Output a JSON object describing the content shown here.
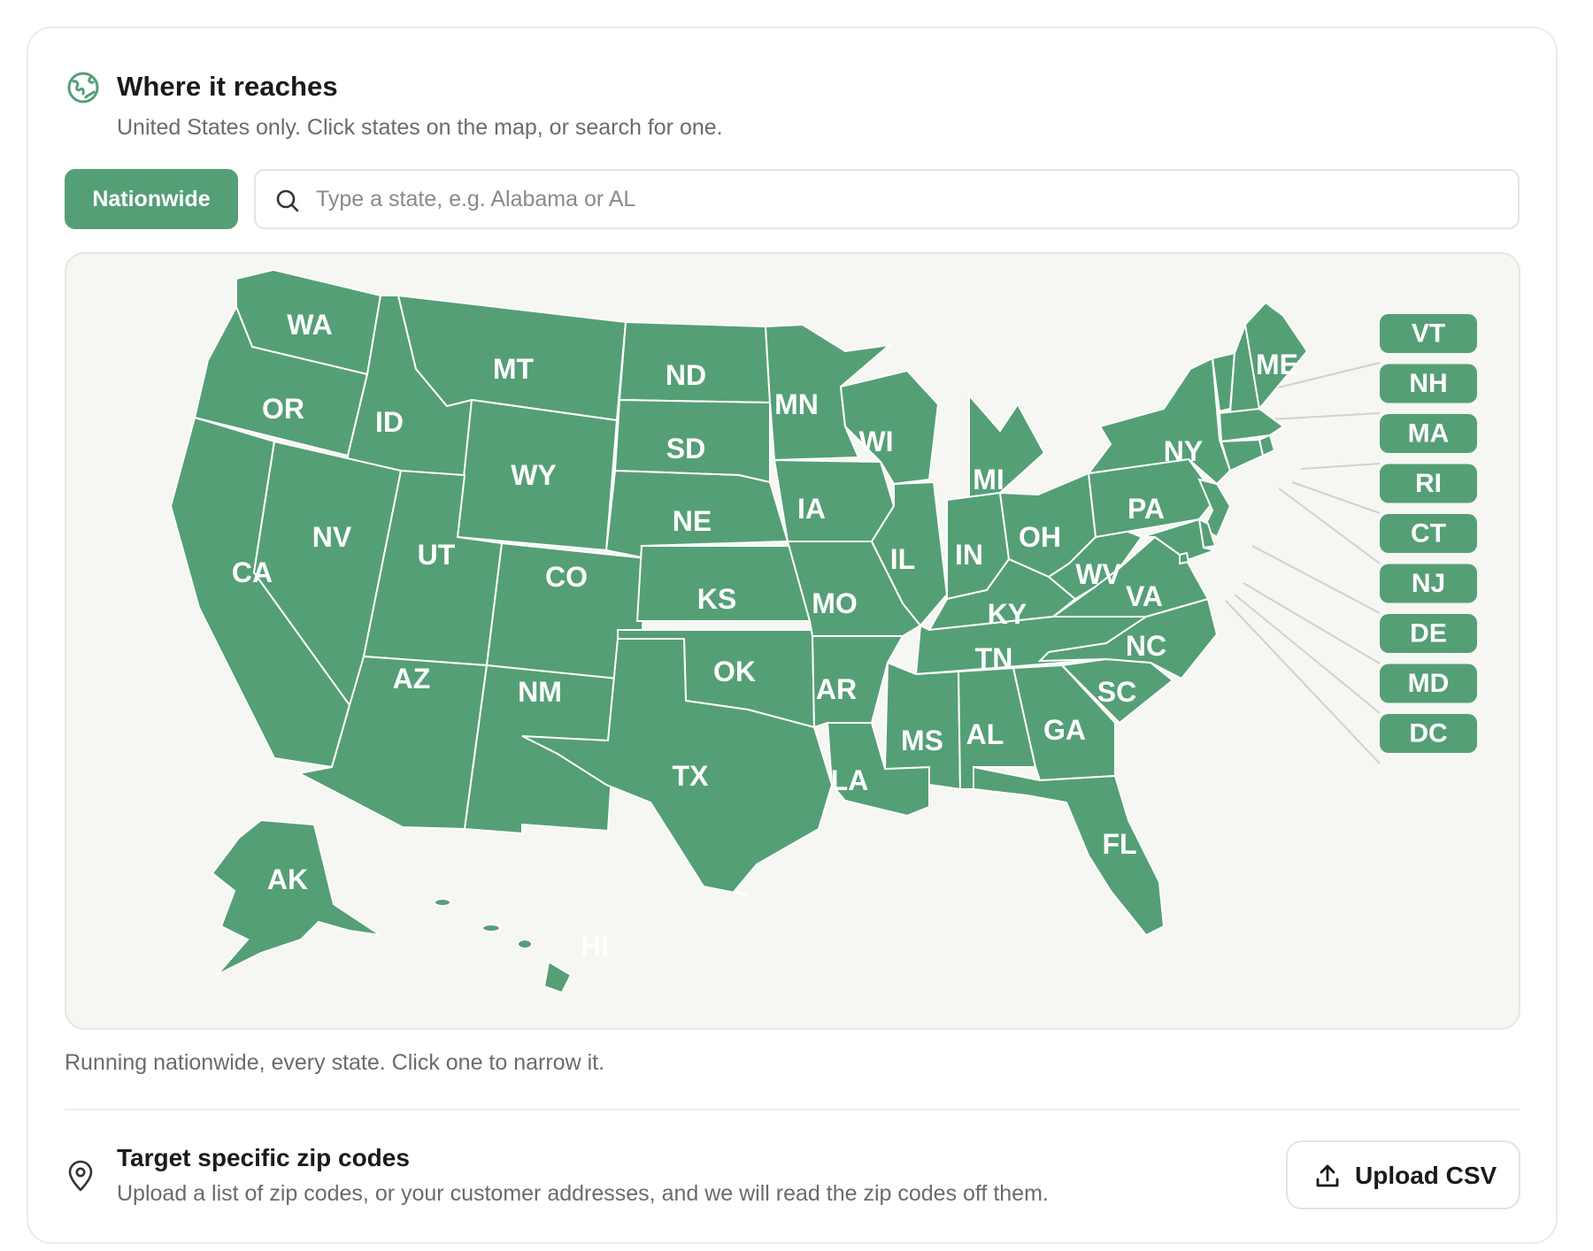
{
  "header": {
    "title": "Where it reaches",
    "subtitle": "United States only. Click states on the map, or search for one.",
    "icon": "globe-icon"
  },
  "controls": {
    "nationwide_label": "Nationwide",
    "search_placeholder": "Type a state, e.g. Alabama or AL"
  },
  "map": {
    "fill_color": "#559f76",
    "border_color": "#ffffff",
    "background_color": "#f6f6f3",
    "states": [
      "WA",
      "OR",
      "CA",
      "ID",
      "NV",
      "MT",
      "WY",
      "UT",
      "AZ",
      "CO",
      "NM",
      "ND",
      "SD",
      "NE",
      "KS",
      "OK",
      "TX",
      "MN",
      "IA",
      "MO",
      "AR",
      "LA",
      "WI",
      "IL",
      "MI",
      "IN",
      "OH",
      "KY",
      "TN",
      "MS",
      "AL",
      "GA",
      "FL",
      "SC",
      "NC",
      "VA",
      "WV",
      "PA",
      "NY",
      "ME",
      "AK",
      "HI"
    ],
    "small_states": [
      "VT",
      "NH",
      "MA",
      "RI",
      "CT",
      "NJ",
      "DE",
      "MD",
      "DC"
    ]
  },
  "status_note": "Running nationwide, every state. Click one to narrow it.",
  "zip_section": {
    "title": "Target specific zip codes",
    "description": "Upload a list of zip codes, or your customer addresses, and we will read the zip codes off them.",
    "upload_label": "Upload CSV",
    "icon": "map-pin-icon",
    "upload_icon": "upload-icon"
  }
}
